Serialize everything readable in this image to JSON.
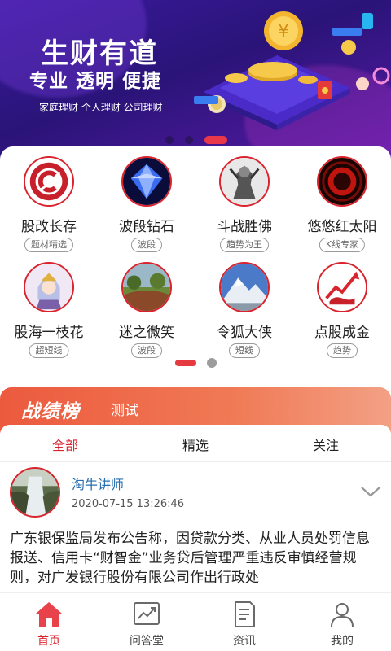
{
  "banner": {
    "title": "生财有道",
    "subtitle": "专业 透明 便捷",
    "tags": "家庭理财 个人理财 公司理财",
    "carousel_count": 3,
    "carousel_active": 3
  },
  "grid": {
    "items": [
      {
        "name": "股改长存",
        "tag": "题材精选",
        "icon": "stock-logo-icon"
      },
      {
        "name": "波段钻石",
        "tag": "波段",
        "icon": "diamond-icon"
      },
      {
        "name": "斗战胜佛",
        "tag": "趋势为王",
        "icon": "warrior-icon"
      },
      {
        "name": "悠悠红太阳",
        "tag": "K线专家",
        "icon": "red-sun-icon"
      },
      {
        "name": "股海一枝花",
        "tag": "超短线",
        "icon": "anime-character-icon"
      },
      {
        "name": "迷之微笑",
        "tag": "波段",
        "icon": "landscape-icon"
      },
      {
        "name": "令狐大侠",
        "tag": "短线",
        "icon": "mountain-icon"
      },
      {
        "name": "点股成金",
        "tag": "趋势",
        "icon": "bull-chart-icon"
      }
    ],
    "page_count": 2,
    "page_active": 1
  },
  "ranking": {
    "title": "战绩榜",
    "subtitle": "测试"
  },
  "tabs": [
    {
      "label": "全部",
      "active": true
    },
    {
      "label": "精选",
      "active": false
    },
    {
      "label": "关注",
      "active": false
    }
  ],
  "post": {
    "author": "淘牛讲师",
    "time": "2020-07-15 13:26:46",
    "body": "广东银保监局发布公告称，因贷款分类、从业人员处罚信息报送、信用卡“财智金”业务贷后管理严重违反审慎经营规则，对广发银行股份有限公司作出行政处"
  },
  "bottom_nav": [
    {
      "label": "首页",
      "icon": "home-icon",
      "active": true
    },
    {
      "label": "问答堂",
      "icon": "chart-icon",
      "active": false
    },
    {
      "label": "资讯",
      "icon": "news-icon",
      "active": false
    },
    {
      "label": "我的",
      "icon": "user-icon",
      "active": false
    }
  ],
  "colors": {
    "accent": "#d9242e",
    "banner_bg": "#2a1478",
    "ranking_gradient_start": "#ec5a3e",
    "link": "#2a6fb0"
  }
}
